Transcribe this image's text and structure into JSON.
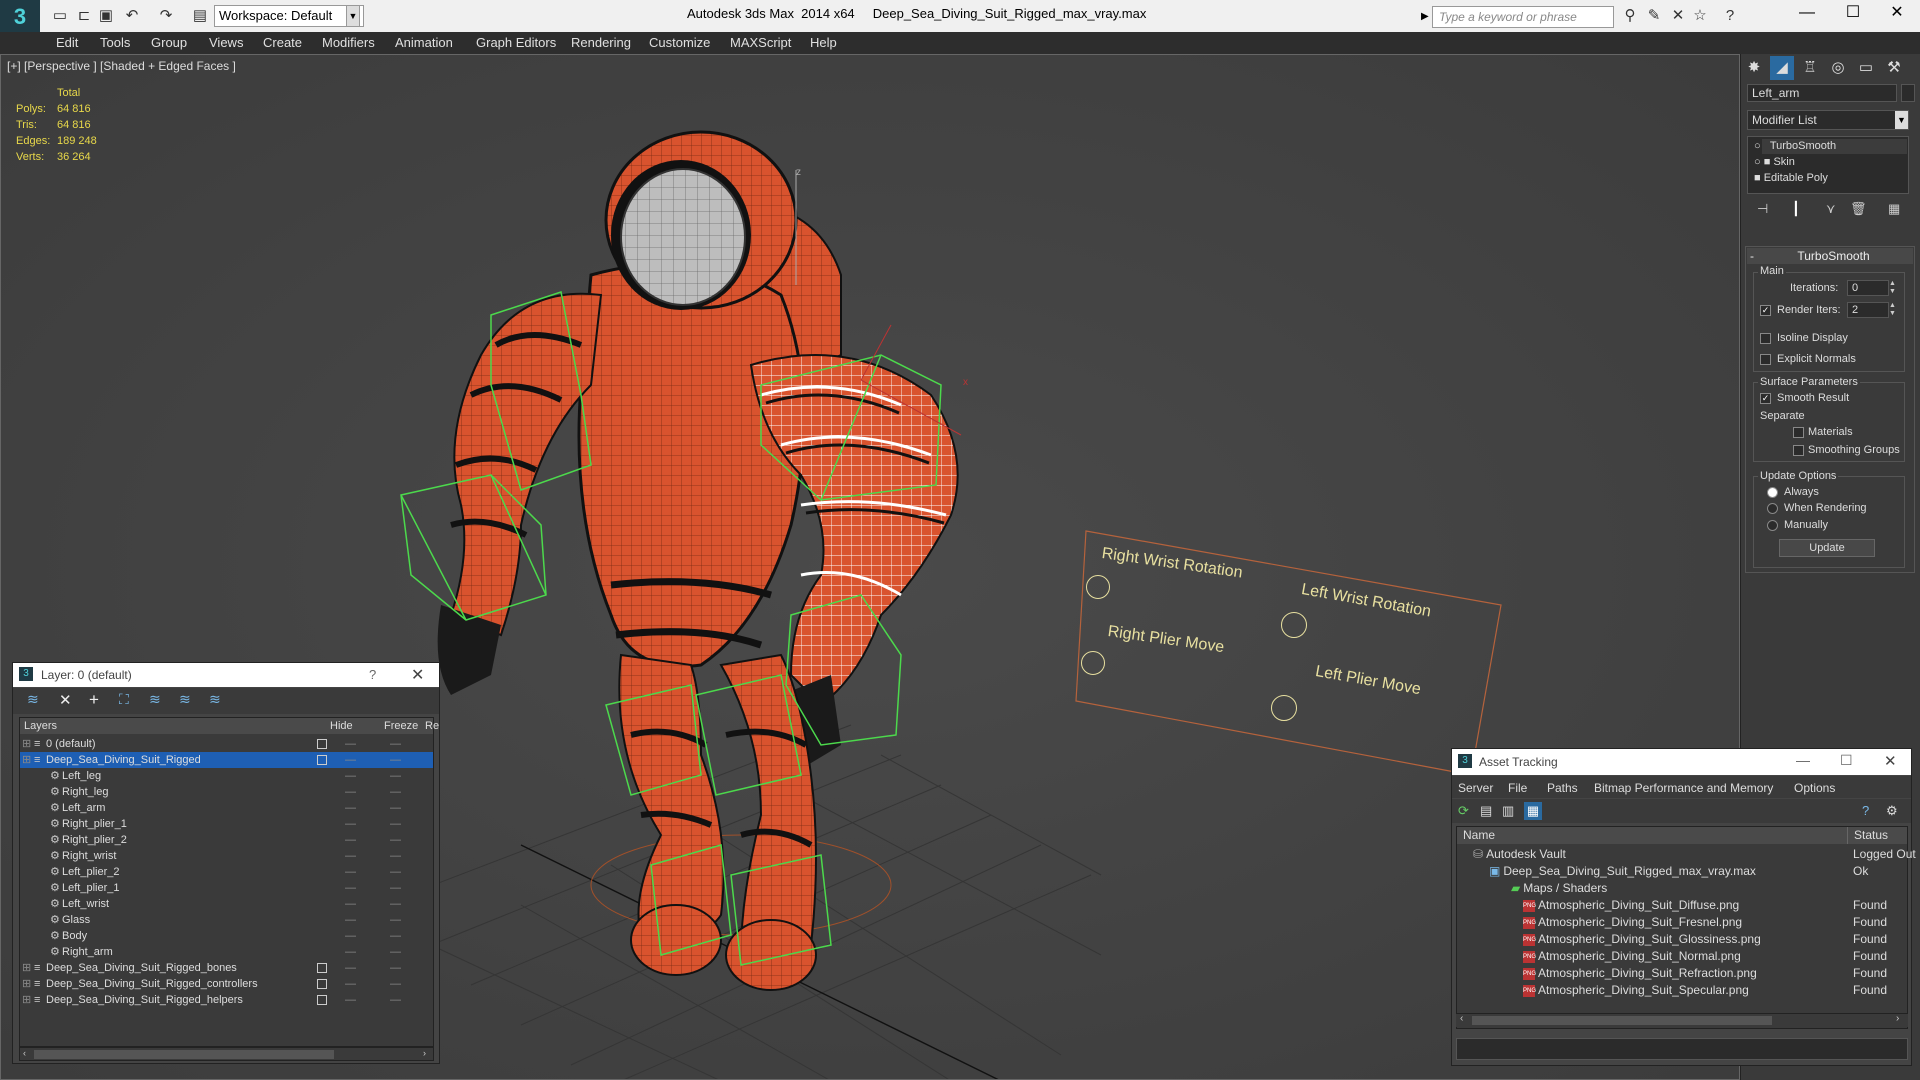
{
  "titlebar": {
    "workspace": "Workspace: Default",
    "app_name": "Autodesk 3ds Max  2014 x64",
    "file_name": "Deep_Sea_Diving_Suit_Rigged_max_vray.max",
    "search_placeholder": "Type a keyword or phrase"
  },
  "menu": [
    "Edit",
    "Tools",
    "Group",
    "Views",
    "Create",
    "Modifiers",
    "Animation",
    "Graph Editors",
    "Rendering",
    "Customize",
    "MAXScript",
    "Help"
  ],
  "viewport": {
    "label": "[+] [Perspective ] [Shaded + Edged Faces ]",
    "stats": {
      "header": "Total",
      "rows": [
        {
          "label": "Polys:",
          "value": "64 816"
        },
        {
          "label": "Tris:",
          "value": "64 816"
        },
        {
          "label": "Edges:",
          "value": "189 248"
        },
        {
          "label": "Verts:",
          "value": "36 264"
        }
      ]
    },
    "controls": {
      "right_wrist": "Right Wrist Rotation",
      "left_wrist": "Left Wrist Rotation",
      "right_plier": "Right Plier Move",
      "left_plier": "Left Plier Move"
    }
  },
  "command_panel": {
    "object_name": "Left_arm",
    "modifier_list": "Modifier List",
    "stack": [
      "TurboSmooth",
      "Skin",
      "Editable Poly"
    ],
    "rollout_title": "TurboSmooth",
    "main_label": "Main",
    "iterations_label": "Iterations:",
    "iterations_value": "0",
    "render_iters_label": "Render Iters:",
    "render_iters_value": "2",
    "isoline": "Isoline Display",
    "explicit_normals": "Explicit Normals",
    "surface_params": "Surface Parameters",
    "smooth_result": "Smooth Result",
    "separate": "Separate",
    "materials": "Materials",
    "smoothing_groups": "Smoothing Groups",
    "update_options": "Update Options",
    "always": "Always",
    "when_rendering": "When Rendering",
    "manually": "Manually",
    "update_button": "Update"
  },
  "layer_window": {
    "title": "Layer: 0 (default)",
    "help": "?",
    "col_layers": "Layers",
    "col_hide": "Hide",
    "col_freeze": "Freeze",
    "col_re": "Re",
    "rows": [
      {
        "name": "0 (default)",
        "indent": 0
      },
      {
        "name": "Deep_Sea_Diving_Suit_Rigged",
        "indent": 0,
        "selected": true
      },
      {
        "name": "Left_leg",
        "indent": 1
      },
      {
        "name": "Right_leg",
        "indent": 1
      },
      {
        "name": "Left_arm",
        "indent": 1
      },
      {
        "name": "Right_plier_1",
        "indent": 1
      },
      {
        "name": "Right_plier_2",
        "indent": 1
      },
      {
        "name": "Right_wrist",
        "indent": 1
      },
      {
        "name": "Left_plier_2",
        "indent": 1
      },
      {
        "name": "Left_plier_1",
        "indent": 1
      },
      {
        "name": "Left_wrist",
        "indent": 1
      },
      {
        "name": "Glass",
        "indent": 1
      },
      {
        "name": "Body",
        "indent": 1
      },
      {
        "name": "Right_arm",
        "indent": 1
      },
      {
        "name": "Deep_Sea_Diving_Suit_Rigged_bones",
        "indent": 0
      },
      {
        "name": "Deep_Sea_Diving_Suit_Rigged_controllers",
        "indent": 0
      },
      {
        "name": "Deep_Sea_Diving_Suit_Rigged_helpers",
        "indent": 0
      }
    ]
  },
  "asset_tracking": {
    "title": "Asset Tracking",
    "menu": [
      "Server",
      "File",
      "Paths",
      "Bitmap Performance and Memory",
      "Options"
    ],
    "col_name": "Name",
    "col_status": "Status",
    "rows": [
      {
        "name": "Autodesk Vault",
        "status": "Logged Out"
      },
      {
        "name": "Deep_Sea_Diving_Suit_Rigged_max_vray.max",
        "status": "Ok"
      },
      {
        "name": "Maps / Shaders",
        "status": ""
      },
      {
        "name": "Atmospheric_Diving_Suit_Diffuse.png",
        "status": "Found"
      },
      {
        "name": "Atmospheric_Diving_Suit_Fresnel.png",
        "status": "Found"
      },
      {
        "name": "Atmospheric_Diving_Suit_Glossiness.png",
        "status": "Found"
      },
      {
        "name": "Atmospheric_Diving_Suit_Normal.png",
        "status": "Found"
      },
      {
        "name": "Atmospheric_Diving_Suit_Refraction.png",
        "status": "Found"
      },
      {
        "name": "Atmospheric_Diving_Suit_Specular.png",
        "status": "Found"
      }
    ]
  }
}
